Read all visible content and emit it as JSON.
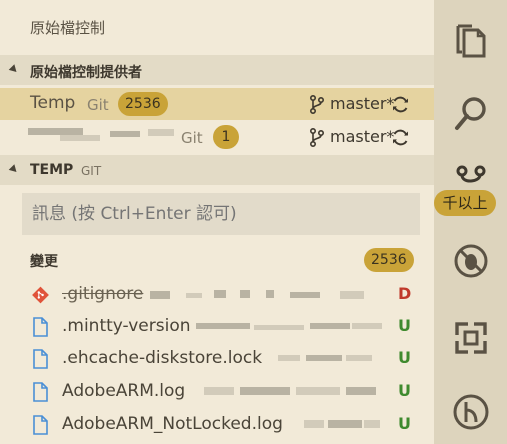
{
  "view_title": "原始檔控制",
  "providers_section": {
    "label": "原始檔控制提供者"
  },
  "repositories": [
    {
      "name": "Temp",
      "kind": "Git",
      "count": "2536",
      "branch": "master*",
      "selected": true
    },
    {
      "name": "",
      "kind": "Git",
      "count": "1",
      "branch": "master*",
      "selected": false
    }
  ],
  "temp_section": {
    "label": "TEMP",
    "sub": "GIT"
  },
  "commit_input": {
    "placeholder": "訊息 (按 Ctrl+Enter 認可)"
  },
  "changes": {
    "label": "變更",
    "count": "2536",
    "files": [
      {
        "name": ".gitignore",
        "status": "D",
        "icon": "git-file-icon"
      },
      {
        "name": ".mintty-version",
        "status": "U",
        "icon": "file-icon"
      },
      {
        "name": ".ehcache-diskstore.lock",
        "status": "U",
        "icon": "file-icon"
      },
      {
        "name": "AdobeARM.log",
        "status": "U",
        "icon": "file-icon"
      },
      {
        "name": "AdobeARM_NotLocked.log",
        "status": "U",
        "icon": "file-icon"
      }
    ]
  },
  "activity_bar": {
    "badge": "千以上",
    "items": [
      "explorer-icon",
      "search-icon",
      "source-control-icon",
      "debug-icon",
      "extensions-icon",
      "git-graph-icon"
    ]
  },
  "colors": {
    "accent": "#c9a338",
    "deleted": "#c0392b",
    "untracked": "#3f8a2e",
    "selected_row": "#e5d3a0"
  }
}
